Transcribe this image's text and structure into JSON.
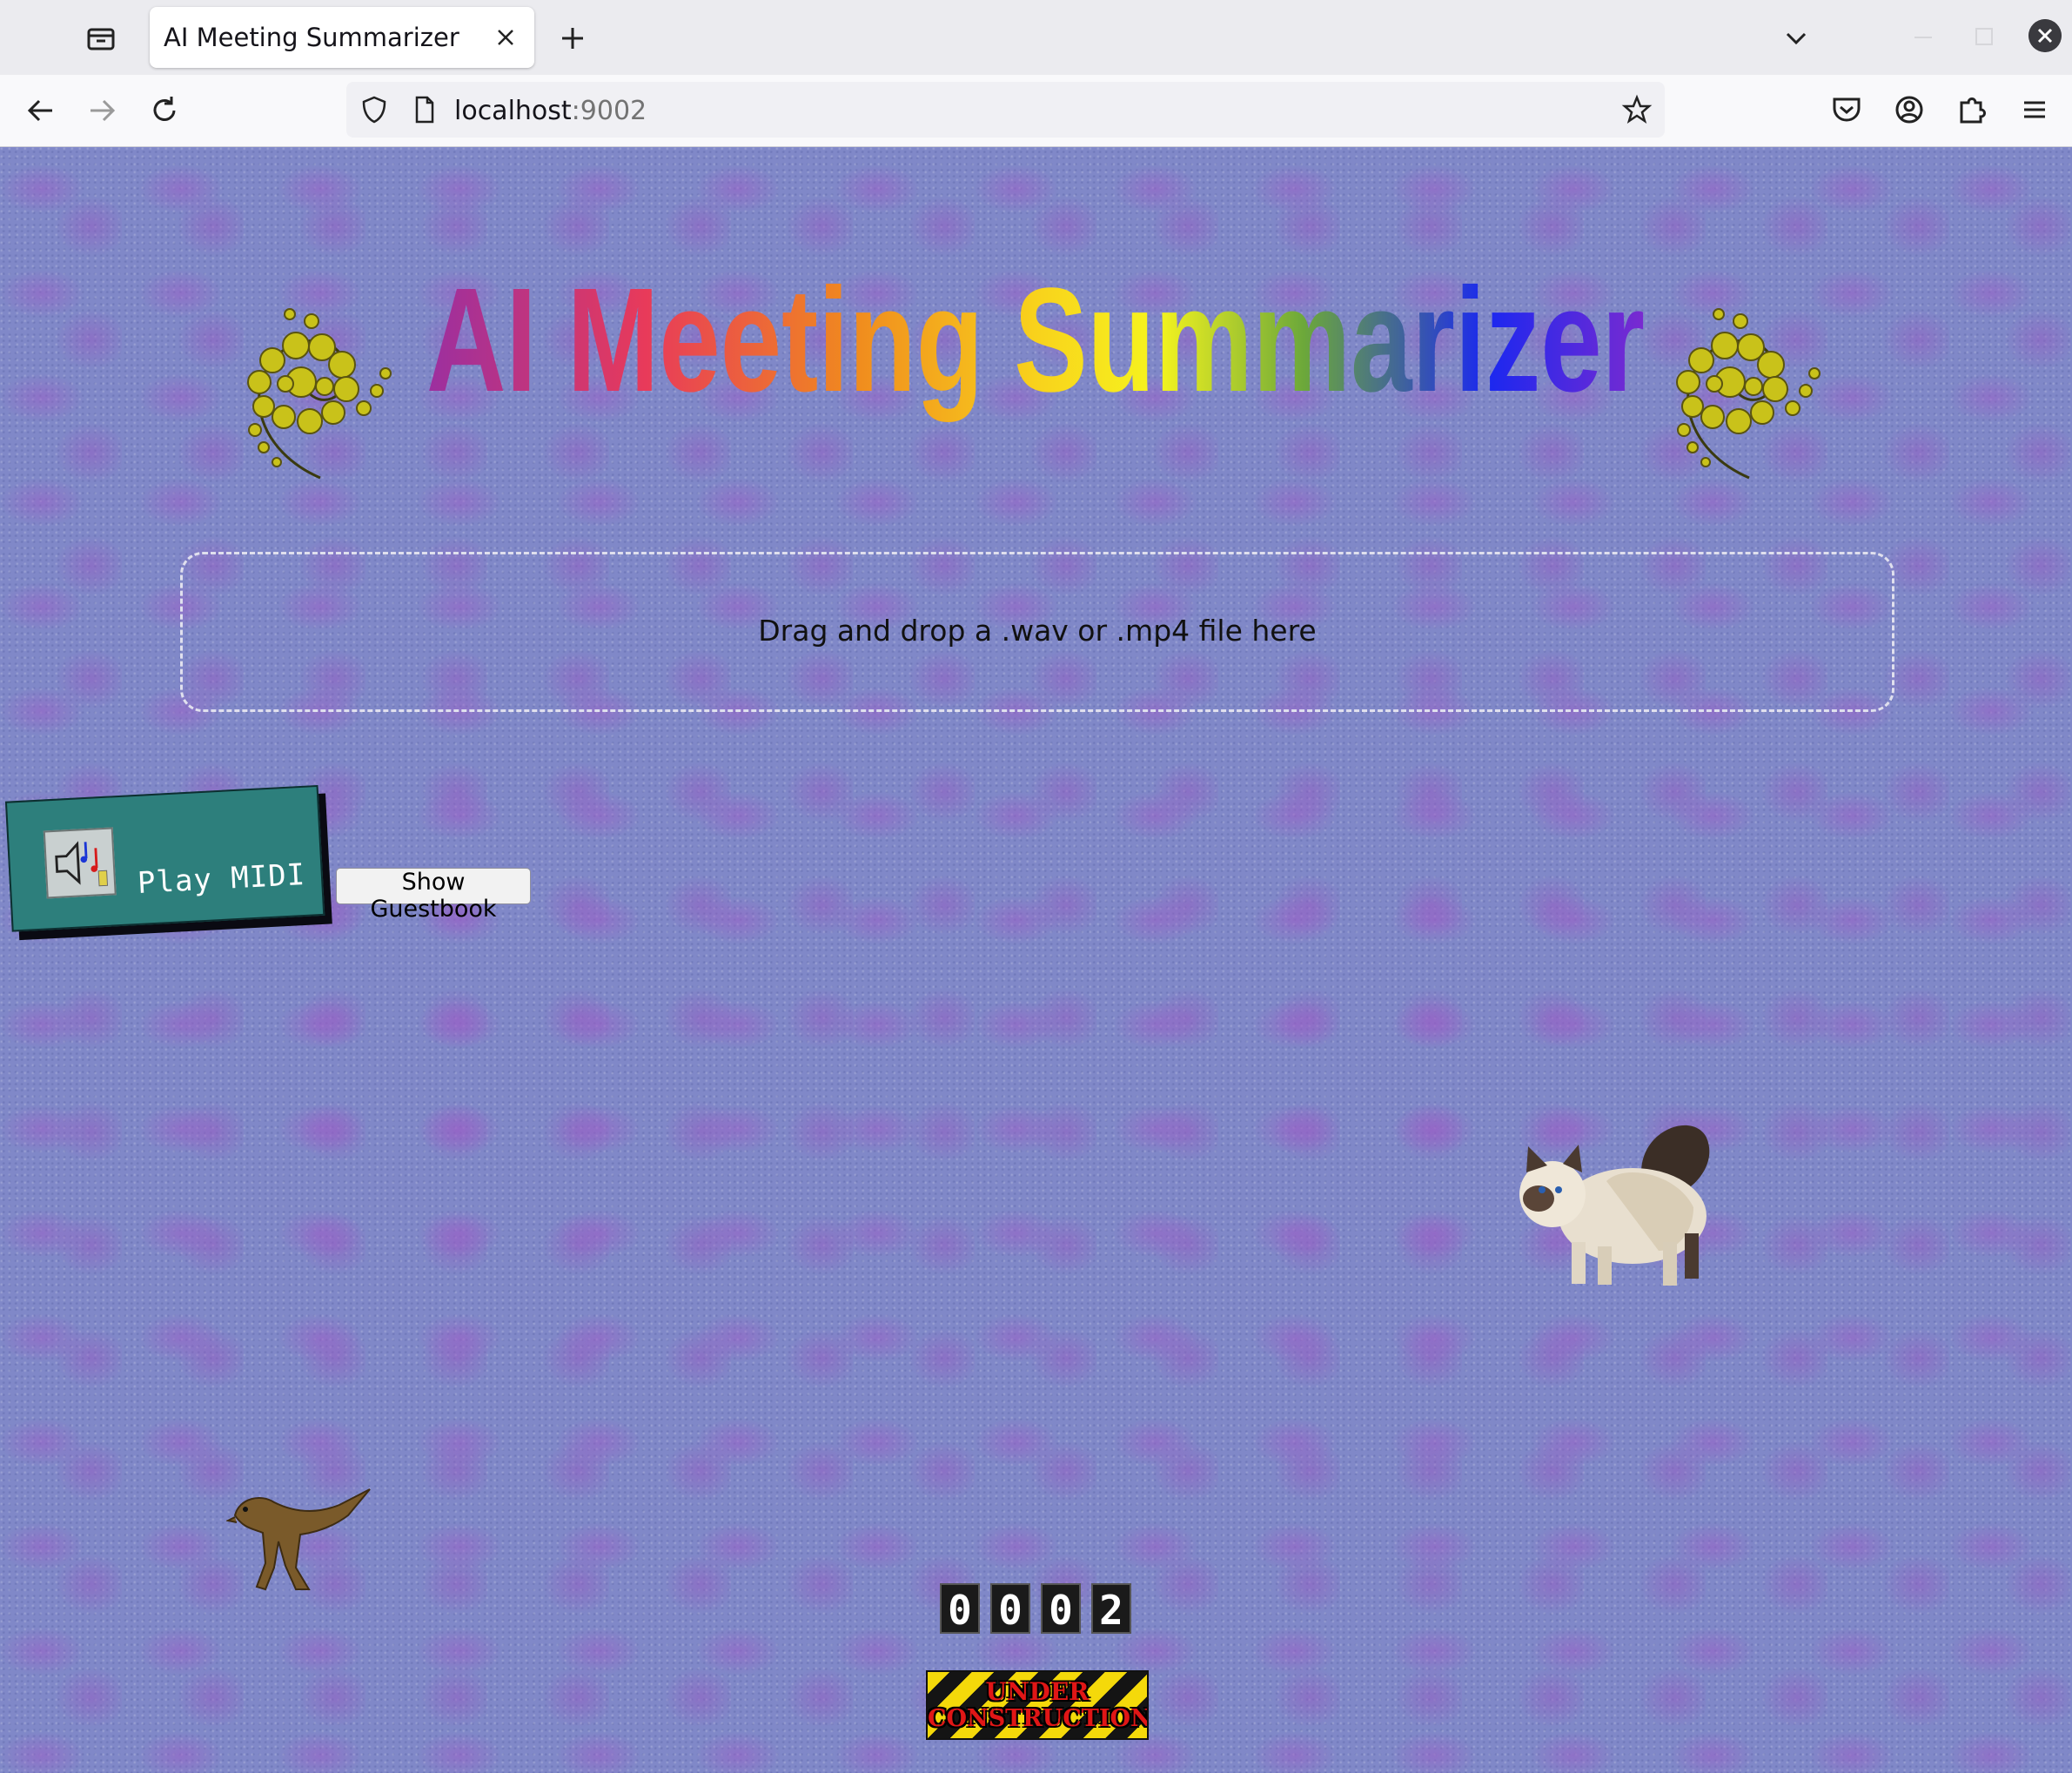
{
  "browser": {
    "tab_title": "AI Meeting Summarizer",
    "url_host": "localhost",
    "url_port": ":9002"
  },
  "page": {
    "title": "AI Meeting Summarizer",
    "dropzone_text": "Drag and drop a .wav or .mp4 file here",
    "midi_button_label": "Play MIDI",
    "guestbook_button_label": "Show Guestbook",
    "counter_digits": [
      "0",
      "0",
      "0",
      "2"
    ],
    "construction_line1": "UNDER",
    "construction_line2": "CONSTRUCTION"
  },
  "colors": {
    "page_background": "#8088c8",
    "midi_button": "#2d7f7c",
    "title_gradient": [
      "#9b2fa0",
      "#e83a5a",
      "#f08a1e",
      "#f8d21c",
      "#f6f41e",
      "#6ca83a",
      "#1a28f0",
      "#7a2ad0"
    ]
  },
  "icons": {
    "tab_bar_left": "tab-overview-icon",
    "new_tab": "plus-icon",
    "back": "back-arrow-icon",
    "forward": "forward-arrow-icon",
    "reload": "reload-icon",
    "shield": "shield-icon",
    "page": "page-icon",
    "bookmark": "star-icon",
    "pocket": "pocket-icon",
    "account": "account-icon",
    "extensions": "puzzle-icon",
    "menu": "hamburger-menu-icon",
    "midi": "speaker-music-icon"
  }
}
